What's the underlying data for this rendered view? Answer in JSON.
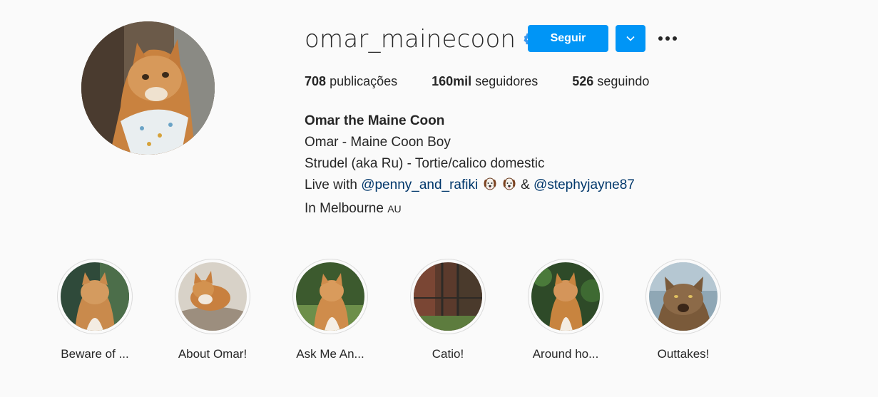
{
  "profile": {
    "username": "omar_mainecoon",
    "follow_label": "Seguir",
    "stats": {
      "posts_count": "708",
      "posts_label": "publicações",
      "followers_count": "160mil",
      "followers_label": "seguidores",
      "following_count": "526",
      "following_label": "seguindo"
    },
    "bio": {
      "full_name": "Omar the Maine Coon",
      "line1": "Omar - Maine Coon Boy",
      "line2": "Strudel (aka Ru) - Tortie/calico domestic",
      "line3_prefix": "Live with",
      "mention1": "@penny_and_rafiki",
      "line3_amp": "&",
      "mention2": "@stephyjayne87",
      "line4": "In Melbourne",
      "line4_flag": "AU"
    }
  },
  "highlights": [
    {
      "label": "Beware of ..."
    },
    {
      "label": "About Omar!"
    },
    {
      "label": "Ask Me An..."
    },
    {
      "label": "Catio!"
    },
    {
      "label": "Around ho..."
    },
    {
      "label": "Outtakes!"
    }
  ],
  "colors": {
    "accent": "#0095f6",
    "link": "#00376b",
    "background": "#fafafa",
    "text": "#262626"
  },
  "icons": [
    "verified-badge-icon",
    "chevron-down-icon",
    "more-options-icon",
    "dog-emoji-icon"
  ]
}
